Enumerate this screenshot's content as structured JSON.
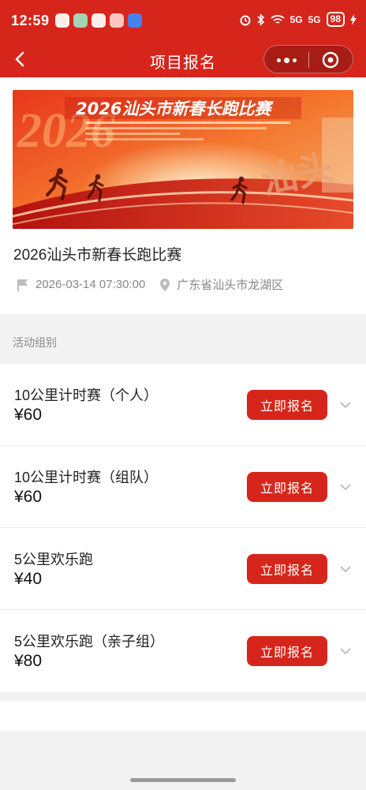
{
  "status_bar": {
    "time": "12:59",
    "battery": "98",
    "signal_1": "5G",
    "signal_2": "5G"
  },
  "nav": {
    "title": "项目报名"
  },
  "event": {
    "banner_title": "2026汕头市新春长跑比赛",
    "banner_numeral": "2026",
    "banner_calligraphy": "汕头",
    "name": "2026汕头市新春长跑比赛",
    "datetime": "2026-03-14 07:30:00",
    "location": "广东省汕头市龙湖区"
  },
  "section": {
    "label": "活动组别"
  },
  "groups": [
    {
      "name": "10公里计时赛（个人）",
      "price": "¥60",
      "button": "立即报名"
    },
    {
      "name": "10公里计时赛（组队）",
      "price": "¥60",
      "button": "立即报名"
    },
    {
      "name": "5公里欢乐跑",
      "price": "¥40",
      "button": "立即报名"
    },
    {
      "name": "5公里欢乐跑（亲子组）",
      "price": "¥80",
      "button": "立即报名"
    }
  ],
  "colors": {
    "brand_red": "#d6261c",
    "page_bg": "#f2f2f2"
  },
  "icons": {
    "back": "chevron-left-icon",
    "more": "more-dots-icon",
    "close": "target-circle-icon",
    "date": "flag-icon",
    "location": "map-pin-icon",
    "expand": "chevron-down-icon"
  }
}
